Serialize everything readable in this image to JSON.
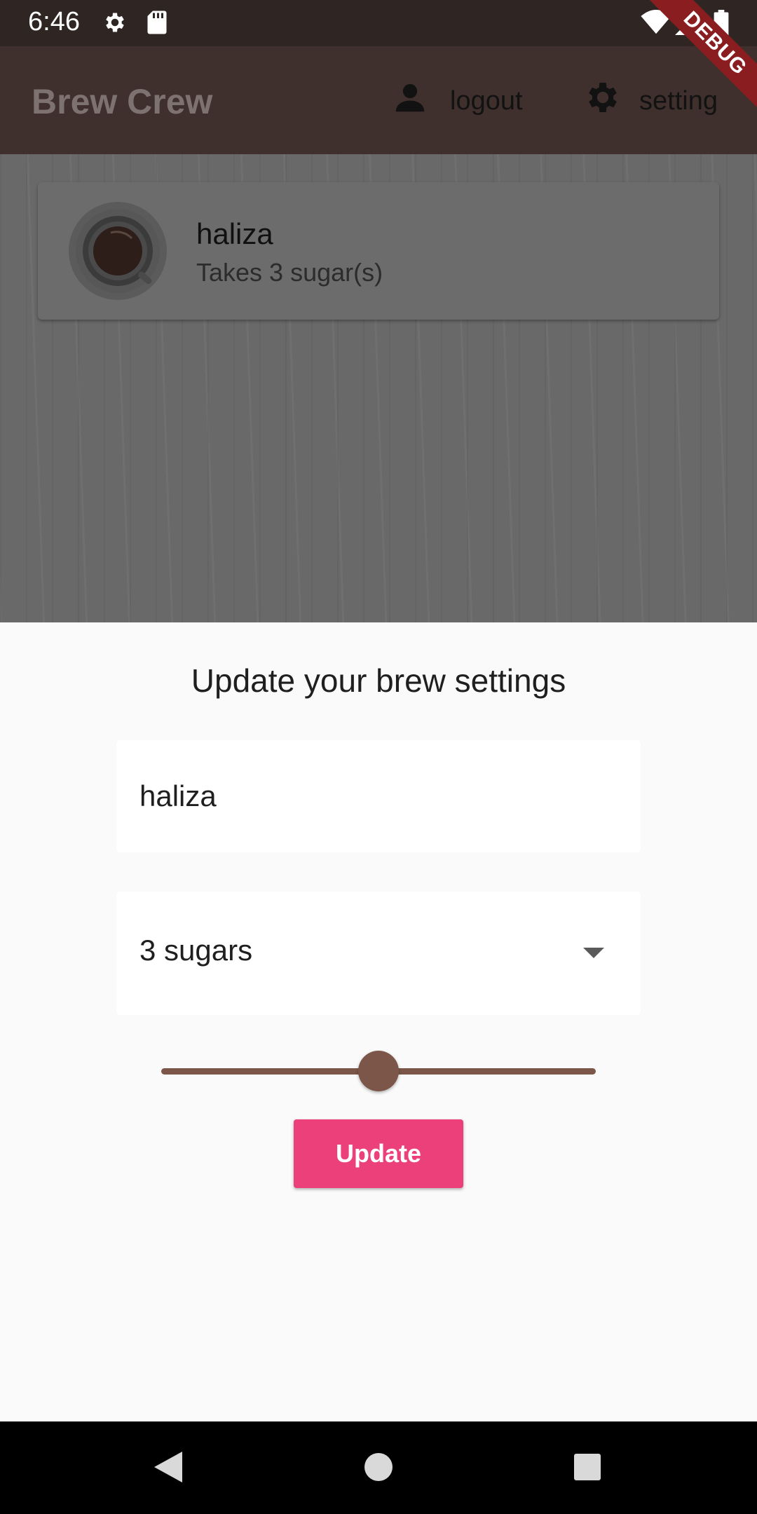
{
  "status_bar": {
    "time": "6:46",
    "icons": [
      "settings-icon",
      "sd-card-icon",
      "wifi-icon",
      "signal-icon",
      "battery-icon"
    ]
  },
  "debug_banner": "DEBUG",
  "app_bar": {
    "title": "Brew Crew",
    "logout_label": "logout",
    "settings_label": "setting"
  },
  "brew_list": [
    {
      "name": "haliza",
      "subtitle": "Takes 3 sugar(s)",
      "icon": "coffee-cup-icon"
    }
  ],
  "sheet": {
    "title": "Update your brew settings",
    "name_value": "haliza",
    "sugar_value": "3 sugars",
    "strength_level": 0.5,
    "update_label": "Update"
  },
  "colors": {
    "app_bar": "#3f302d",
    "slider": "#7b5649",
    "button": "#ec407a"
  },
  "nav_bar": [
    "back-icon",
    "home-icon",
    "recents-icon"
  ]
}
